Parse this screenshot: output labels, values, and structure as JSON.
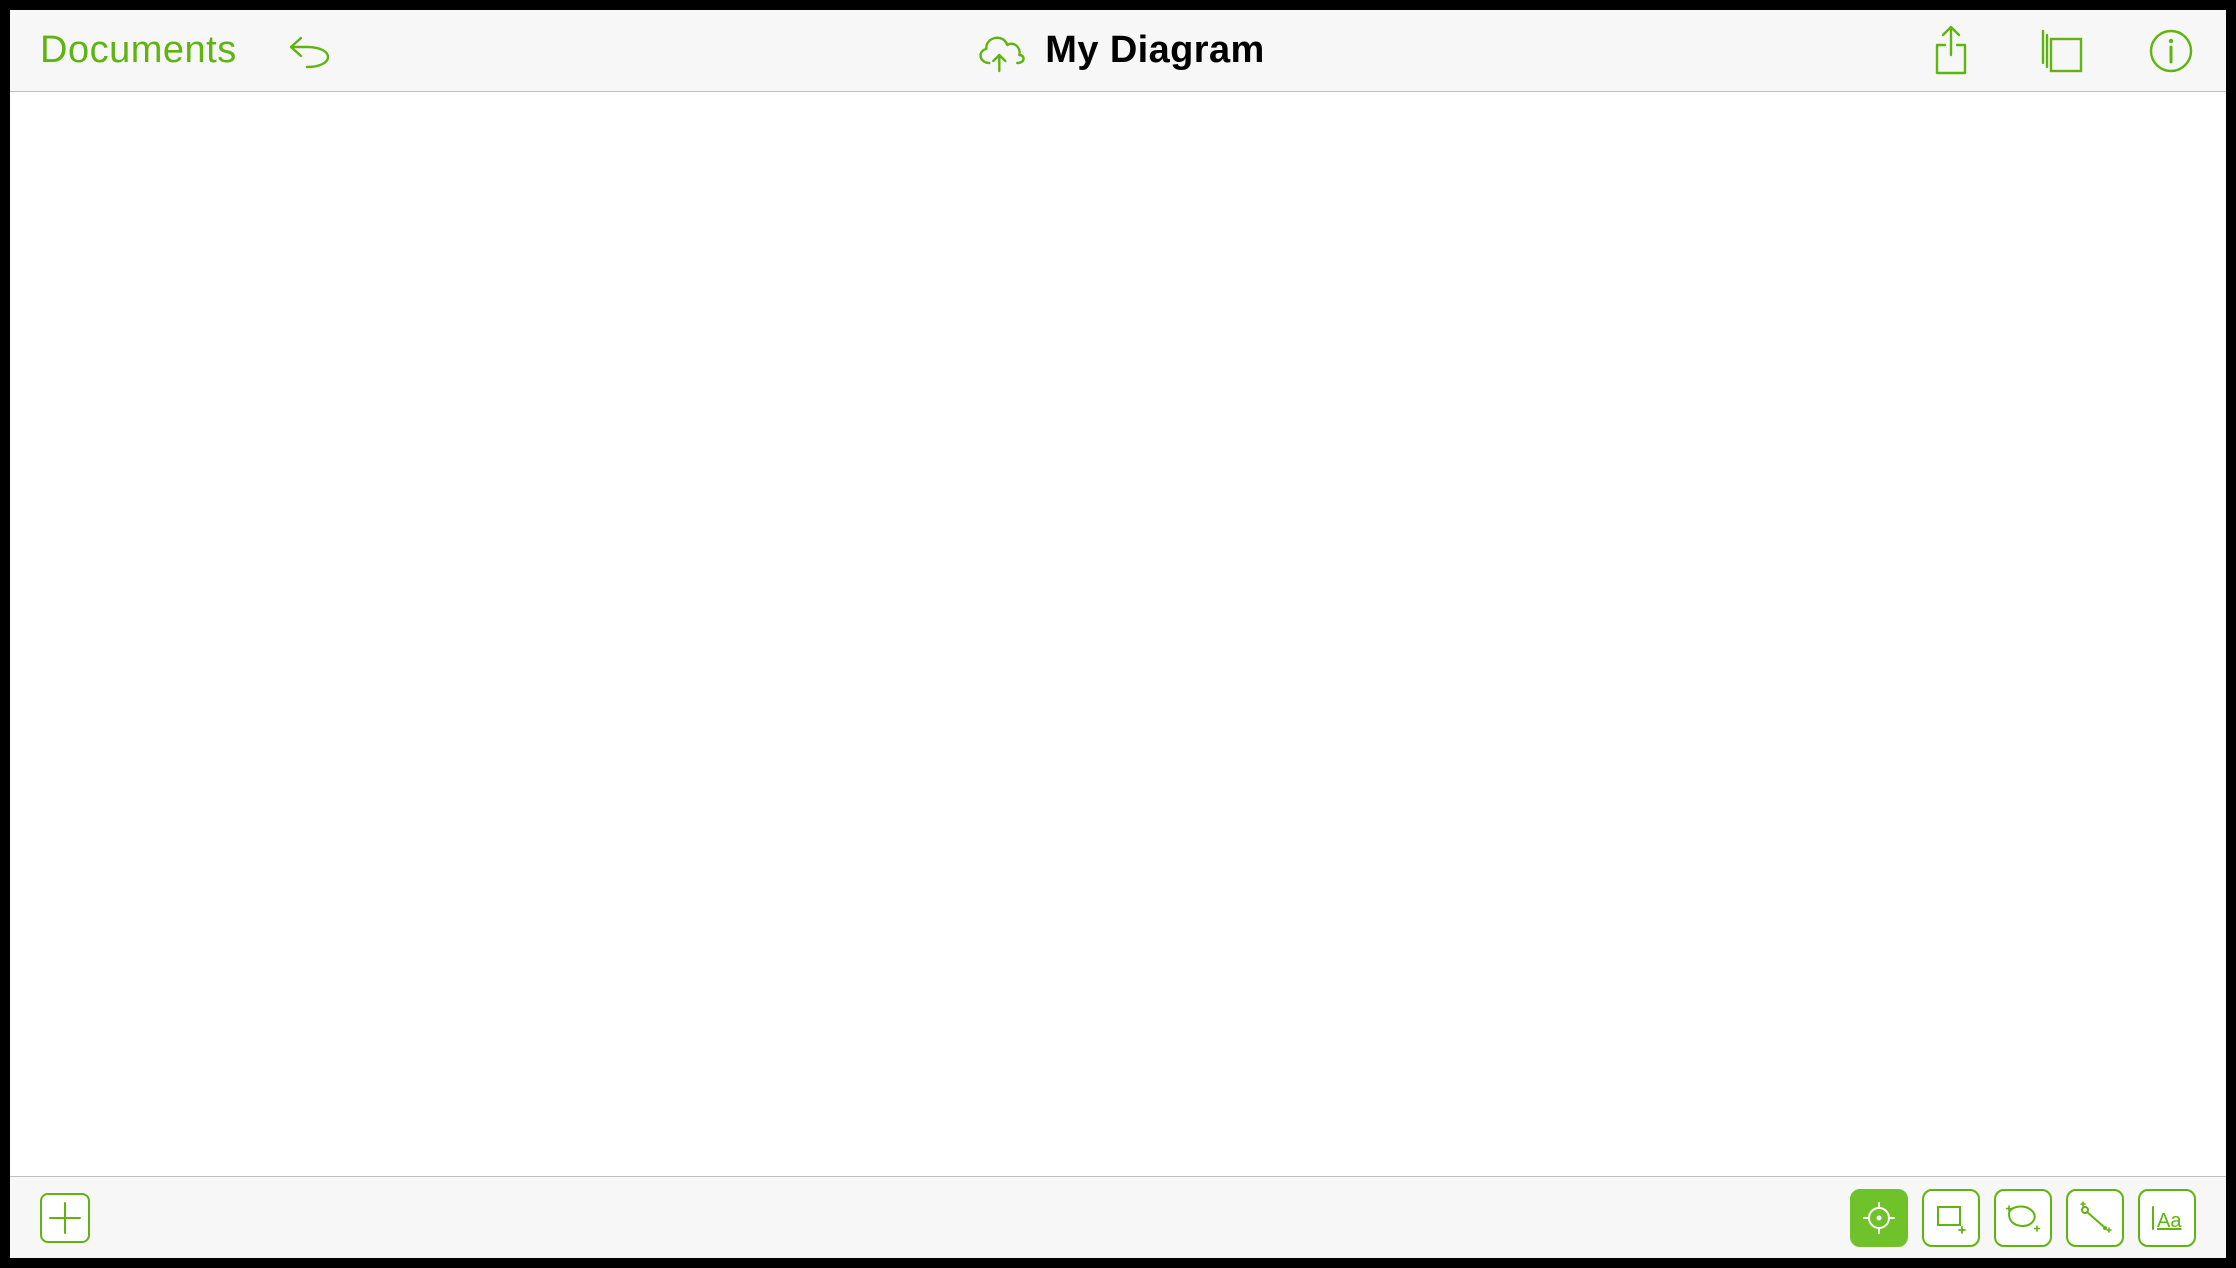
{
  "colors": {
    "accent": "#5fb40f",
    "accent_fill": "#6fc22a",
    "toolbar_bg": "#f7f7f7",
    "divider": "#bfbfbf",
    "title_text": "#000000"
  },
  "top_toolbar": {
    "documents_label": "Documents",
    "document_title": "My Diagram",
    "icons": {
      "undo": "undo-icon",
      "cloud_sync": "cloud-sync-icon",
      "share": "share-icon",
      "canvases": "canvases-stack-icon",
      "info": "info-icon"
    }
  },
  "bottom_toolbar": {
    "add_icon": "plus-icon",
    "tools": [
      {
        "name": "selection-tool",
        "icon": "crosshair-icon",
        "selected": true
      },
      {
        "name": "shape-tool",
        "icon": "rectangle-add-icon",
        "selected": false
      },
      {
        "name": "freehand-tool",
        "icon": "freehand-loop-icon",
        "selected": false
      },
      {
        "name": "line-tool",
        "icon": "line-connect-icon",
        "selected": false
      },
      {
        "name": "text-tool",
        "icon": "text-aa-icon",
        "selected": false
      }
    ]
  }
}
